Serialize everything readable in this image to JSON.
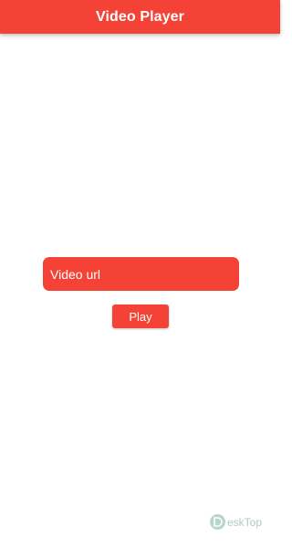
{
  "app_bar": {
    "title": "Video Player",
    "color": "#f44336"
  },
  "form": {
    "url_placeholder": "Video url",
    "url_value": "",
    "play_label": "Play"
  },
  "watermark": {
    "text": "eskTop",
    "icon": "d-logo-icon"
  }
}
